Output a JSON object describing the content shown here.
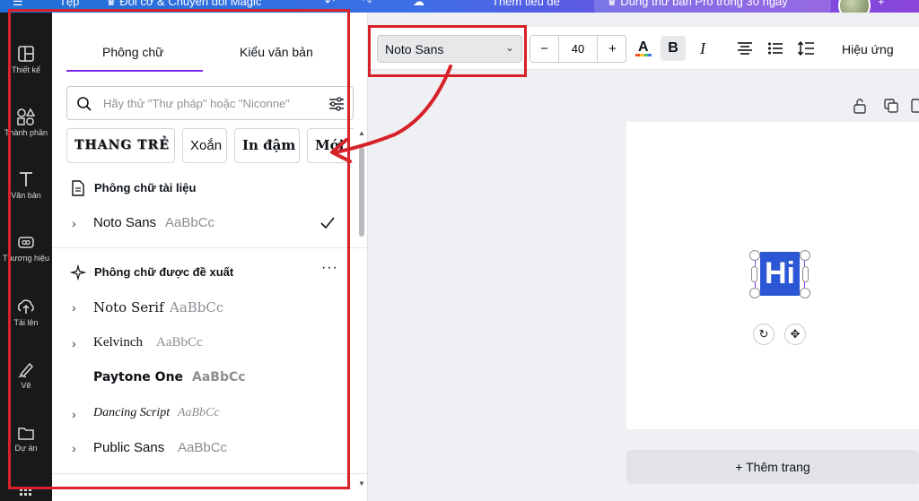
{
  "topbar": {
    "file_label": "Tệp",
    "magic_label": "Đổi cỡ & Chuyển đổi Magic",
    "doc_title": "Thêm tiêu đề",
    "pro_trial": "Dùng thử bản Pro trong 30 ngày"
  },
  "rail": {
    "items": [
      {
        "label": "Thiết kế",
        "icon": "layout-icon"
      },
      {
        "label": "Thành phần",
        "icon": "shapes-icon"
      },
      {
        "label": "Văn bản",
        "icon": "text-icon"
      },
      {
        "label": "Thương hiệu",
        "icon": "brand-icon"
      },
      {
        "label": "Tải lên",
        "icon": "upload-icon"
      },
      {
        "label": "Vẽ",
        "icon": "draw-icon"
      },
      {
        "label": "Dự án",
        "icon": "folder-icon"
      }
    ]
  },
  "panel": {
    "tabs": [
      "Phông chữ",
      "Kiểu văn bản"
    ],
    "search_placeholder": "Hãy thử \"Thư pháp\" hoặc \"Niconne\"",
    "chips": [
      "THANG TRẺ",
      "Xoắn",
      "In đậm",
      "Mới"
    ],
    "document_fonts_title": "Phông chữ tài liệu",
    "document_fonts": [
      {
        "name": "Noto Sans",
        "sample": "AaBbCc",
        "selected": true
      }
    ],
    "suggested_title": "Phông chữ được đề xuất",
    "suggested_fonts": [
      {
        "name": "Noto Serif",
        "sample": "AaBbCc"
      },
      {
        "name": "Kelvinch",
        "sample": "AaBbCc"
      },
      {
        "name": "Paytone One",
        "sample": "AaBbCc"
      },
      {
        "name": "Dancing Script",
        "sample": "AaBbCc"
      },
      {
        "name": "Public Sans",
        "sample": "AaBbCc"
      }
    ]
  },
  "toolbar": {
    "font_name": "Noto Sans",
    "font_size": "40",
    "minus": "−",
    "plus": "+",
    "bold": "B",
    "italic": "I",
    "effects_label": "Hiệu ứng"
  },
  "canvas": {
    "text_content": "Hi",
    "text_bg_color": "#2b56d4",
    "add_page_label": "+ Thêm trang"
  },
  "colors": {
    "accent": "#7d2ae8",
    "annotation": "#d8222a"
  }
}
